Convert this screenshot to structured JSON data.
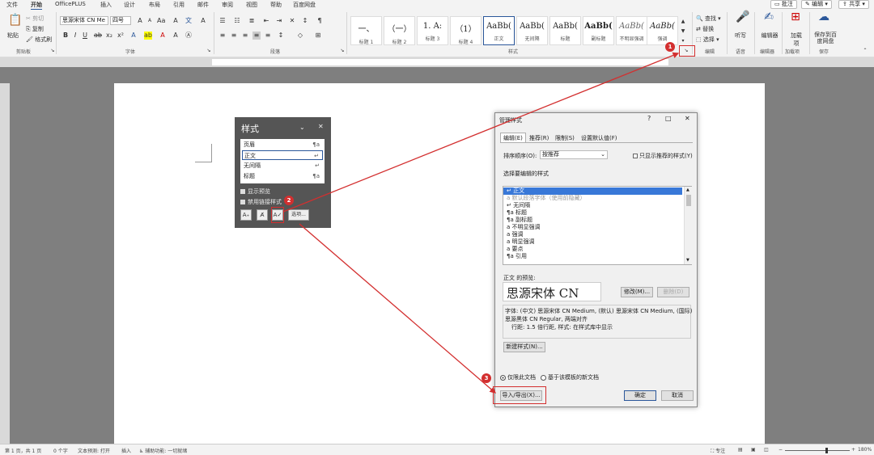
{
  "tabs": {
    "items": [
      "文件",
      "开始",
      "OfficePLUS",
      "插入",
      "设计",
      "布局",
      "引用",
      "邮件",
      "审阅",
      "视图",
      "帮助",
      "百度网盘"
    ],
    "active": "开始",
    "comments": "批注",
    "editing": "编辑",
    "share": "共享"
  },
  "ribbon": {
    "clipboard": {
      "paste": "粘贴",
      "cut": "剪切",
      "copy": "复制",
      "painter": "格式刷",
      "label": "剪贴板"
    },
    "font": {
      "name": "思源宋体 CN Me",
      "size": "四号",
      "label": "字体"
    },
    "paragraph": {
      "label": "段落"
    },
    "styles": {
      "label": "样式",
      "items": [
        {
          "preview": "一、 ",
          "name": "标题 1"
        },
        {
          "preview": "（一）",
          "name": "标题 2"
        },
        {
          "preview": "1.  A:",
          "name": "标题 3"
        },
        {
          "preview": "（1）",
          "name": "标题 4"
        },
        {
          "preview": "AaBb(",
          "name": "正文"
        },
        {
          "preview": "AaBb(",
          "name": "无间隔"
        },
        {
          "preview": "AaBb(",
          "name": "标题"
        },
        {
          "preview": "AaBb(",
          "name": "副标题"
        },
        {
          "preview": "AaBb(",
          "name": "不明显强调"
        },
        {
          "preview": "AaBb(",
          "name": "强调"
        }
      ]
    },
    "editing": {
      "find": "查找",
      "replace": "替换",
      "select": "选择",
      "label": "编辑"
    },
    "voice": {
      "dictate": "听写",
      "label": "语音"
    },
    "editor": {
      "btn": "编辑器",
      "label": "编辑器"
    },
    "addins": {
      "btn": "加载项",
      "label": "加载项"
    },
    "save": {
      "btn": "保存到百度网盘",
      "label": "保存"
    }
  },
  "style_pane": {
    "title": "样式",
    "items": [
      {
        "name": "页眉",
        "mark": "¶a"
      },
      {
        "name": "正文",
        "mark": "↵"
      },
      {
        "name": "无间隔",
        "mark": "↵"
      },
      {
        "name": "标题",
        "mark": "¶a"
      }
    ],
    "show_preview": "显示预览",
    "disable_linked": "禁用链接样式",
    "options": "选项..."
  },
  "dialog": {
    "title": "管理样式",
    "tabs": [
      "编辑(E)",
      "推荐(R)",
      "限制(S)",
      "设置默认值(F)"
    ],
    "sort_label": "排序顺序(O):",
    "sort_value": "按推荐",
    "show_recommended": "只显示推荐的样式(Y)",
    "select_label": "选择要编辑的样式",
    "styles": [
      "正文",
      "默认段落字体（使用前隐藏）",
      "无间隔",
      "标题",
      "副标题",
      "不明显强调",
      "强调",
      "明显强调",
      "要点",
      "引用"
    ],
    "preview_label": "正文 的预览:",
    "preview_text": "思源宋体 CN",
    "modify": "修改(M)...",
    "delete": "删除(D)",
    "desc1": "字体: (中文) 思源宋体 CN Medium, (默认) 思源宋体 CN Medium, (国际)",
    "desc2": "思源黑体 CN Regular, 两端对齐",
    "desc3": "行距: 1.5 倍行距, 样式: 在样式库中显示",
    "new_style": "新建样式(N)...",
    "radio1": "仅限此文档",
    "radio2": "基于该模板的新文档",
    "import_export": "导入/导出(X)...",
    "ok": "确定",
    "cancel": "取消"
  },
  "callouts": [
    "1",
    "2",
    "3"
  ],
  "status": {
    "page": "第 1 页，共 1 页",
    "words": "0 个字",
    "predict": "文本预测: 打开",
    "insert": "插入",
    "access": "辅助功能: 一切就绪",
    "focus": "专注",
    "zoom": "180%"
  },
  "colors": {
    "accent": "#2b579a",
    "callout": "#d32f2f",
    "pane": "#555555"
  }
}
